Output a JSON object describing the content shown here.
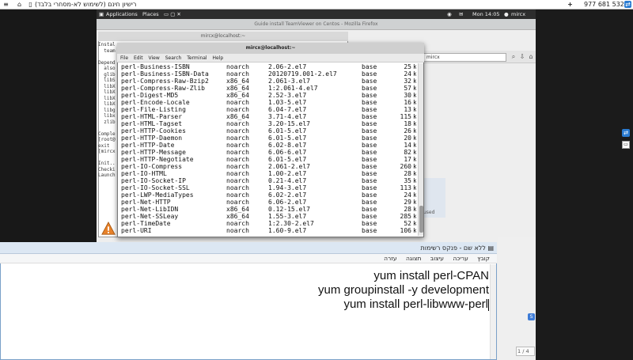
{
  "host_bar": {
    "title": "רישיון חינם (לשימוש לא-מסחרי בלבד)",
    "partner_id": "977 681 532"
  },
  "gnome_bar": {
    "applications": "Applications",
    "places": "Places",
    "clock": "Mon 14:05",
    "user": "mircx"
  },
  "firefox": {
    "window_title": "Guide install TeamViewer on Centos - Mozilla Firefox",
    "search_value": "mircx",
    "used_text": "used"
  },
  "back_terminal": {
    "title": "mircx@localhost:~",
    "lines": [
      "Instal",
      "  team",
      "",
      "Depend",
      "  also",
      "  glib",
      "  libS",
      "  libX",
      "  libX",
      "  libX",
      "  libX",
      "  libg",
      "  libx",
      "  zlib",
      "",
      "Comple",
      "[root@",
      "exit",
      "[mircx",
      "",
      "Init..",
      "Checki",
      "Launch"
    ]
  },
  "terminal": {
    "title": "mircx@localhost:~",
    "menu": [
      "File",
      "Edit",
      "View",
      "Search",
      "Terminal",
      "Help"
    ],
    "rows": [
      [
        "perl-Business-ISBN",
        "noarch",
        "2.06-2.el7",
        "base",
        "25",
        "k"
      ],
      [
        "perl-Business-ISBN-Data",
        "noarch",
        "20120719.001-2.el7",
        "base",
        "24",
        "k"
      ],
      [
        "perl-Compress-Raw-Bzip2",
        "x86_64",
        "2.061-3.el7",
        "base",
        "32",
        "k"
      ],
      [
        "perl-Compress-Raw-Zlib",
        "x86_64",
        "1:2.061-4.el7",
        "base",
        "57",
        "k"
      ],
      [
        "perl-Digest-MD5",
        "x86_64",
        "2.52-3.el7",
        "base",
        "30",
        "k"
      ],
      [
        "perl-Encode-Locale",
        "noarch",
        "1.03-5.el7",
        "base",
        "16",
        "k"
      ],
      [
        "perl-File-Listing",
        "noarch",
        "6.04-7.el7",
        "base",
        "13",
        "k"
      ],
      [
        "perl-HTML-Parser",
        "x86_64",
        "3.71-4.el7",
        "base",
        "115",
        "k"
      ],
      [
        "perl-HTML-Tagset",
        "noarch",
        "3.20-15.el7",
        "base",
        "18",
        "k"
      ],
      [
        "perl-HTTP-Cookies",
        "noarch",
        "6.01-5.el7",
        "base",
        "26",
        "k"
      ],
      [
        "perl-HTTP-Daemon",
        "noarch",
        "6.01-5.el7",
        "base",
        "20",
        "k"
      ],
      [
        "perl-HTTP-Date",
        "noarch",
        "6.02-8.el7",
        "base",
        "14",
        "k"
      ],
      [
        "perl-HTTP-Message",
        "noarch",
        "6.06-6.el7",
        "base",
        "82",
        "k"
      ],
      [
        "perl-HTTP-Negotiate",
        "noarch",
        "6.01-5.el7",
        "base",
        "17",
        "k"
      ],
      [
        "perl-IO-Compress",
        "noarch",
        "2.061-2.el7",
        "base",
        "260",
        "k"
      ],
      [
        "perl-IO-HTML",
        "noarch",
        "1.00-2.el7",
        "base",
        "28",
        "k"
      ],
      [
        "perl-IO-Socket-IP",
        "noarch",
        "0.21-4.el7",
        "base",
        "35",
        "k"
      ],
      [
        "perl-IO-Socket-SSL",
        "noarch",
        "1.94-3.el7",
        "base",
        "113",
        "k"
      ],
      [
        "perl-LWP-MediaTypes",
        "noarch",
        "6.02-2.el7",
        "base",
        "24",
        "k"
      ],
      [
        "perl-Net-HTTP",
        "noarch",
        "6.06-2.el7",
        "base",
        "29",
        "k"
      ],
      [
        "perl-Net-LibIDN",
        "x86_64",
        "0.12-15.el7",
        "base",
        "28",
        "k"
      ],
      [
        "perl-Net-SSLeay",
        "x86_64",
        "1.55-3.el7",
        "base",
        "285",
        "k"
      ],
      [
        "perl-TimeDate",
        "noarch",
        "1:2.30-2.el7",
        "base",
        "52",
        "k"
      ],
      [
        "perl-URI",
        "noarch",
        "1.60-9.el7",
        "base",
        "106",
        "k"
      ]
    ]
  },
  "notepad": {
    "title": "ללא שם - פנקס רשימות",
    "menu": [
      "קובץ",
      "עריכה",
      "עיצוב",
      "תצוגה",
      "עזרה"
    ],
    "lines": [
      "yum install perl-CPAN",
      "yum groupinstall -y development",
      "yum install perl-libwww-perl"
    ]
  },
  "pager": "1 / 4"
}
